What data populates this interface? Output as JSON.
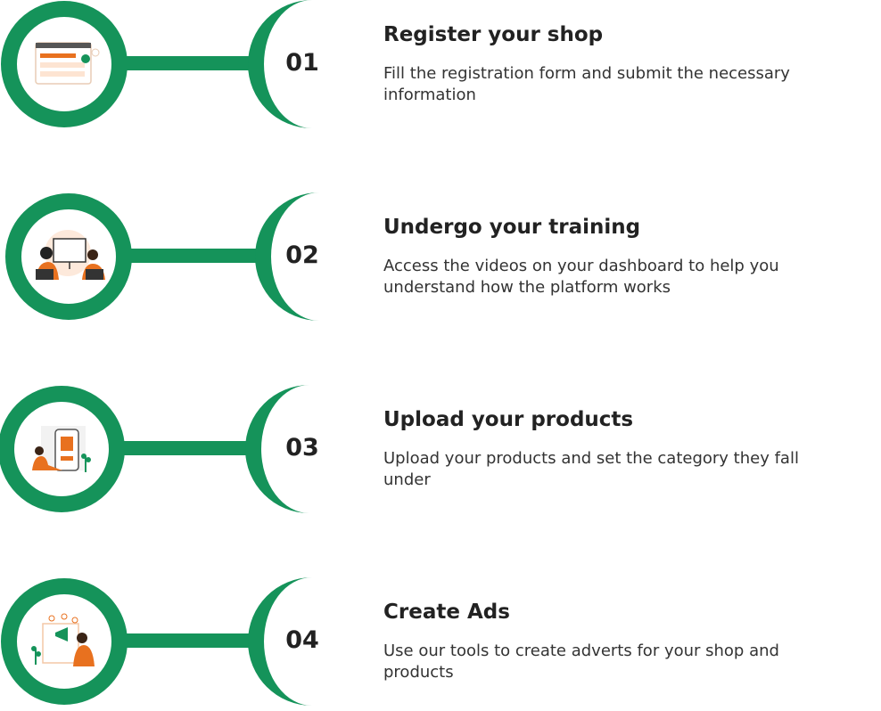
{
  "colors": {
    "accent": "#15935a",
    "illustration": "#e8711f",
    "text": "#222222"
  },
  "steps": [
    {
      "number": "01",
      "title": "Register your shop",
      "description": "Fill the registration form and submit the necessary information",
      "icon": "registration-form-icon"
    },
    {
      "number": "02",
      "title": "Undergo your training",
      "description": "Access the videos on your dashboard to help you understand how the platform works",
      "icon": "training-icon"
    },
    {
      "number": "03",
      "title": "Upload your products",
      "description": "Upload your products and set the category they fall under",
      "icon": "upload-products-icon"
    },
    {
      "number": "04",
      "title": "Create Ads",
      "description": "Use our tools to create adverts for your shop and products",
      "icon": "create-ads-icon"
    }
  ]
}
